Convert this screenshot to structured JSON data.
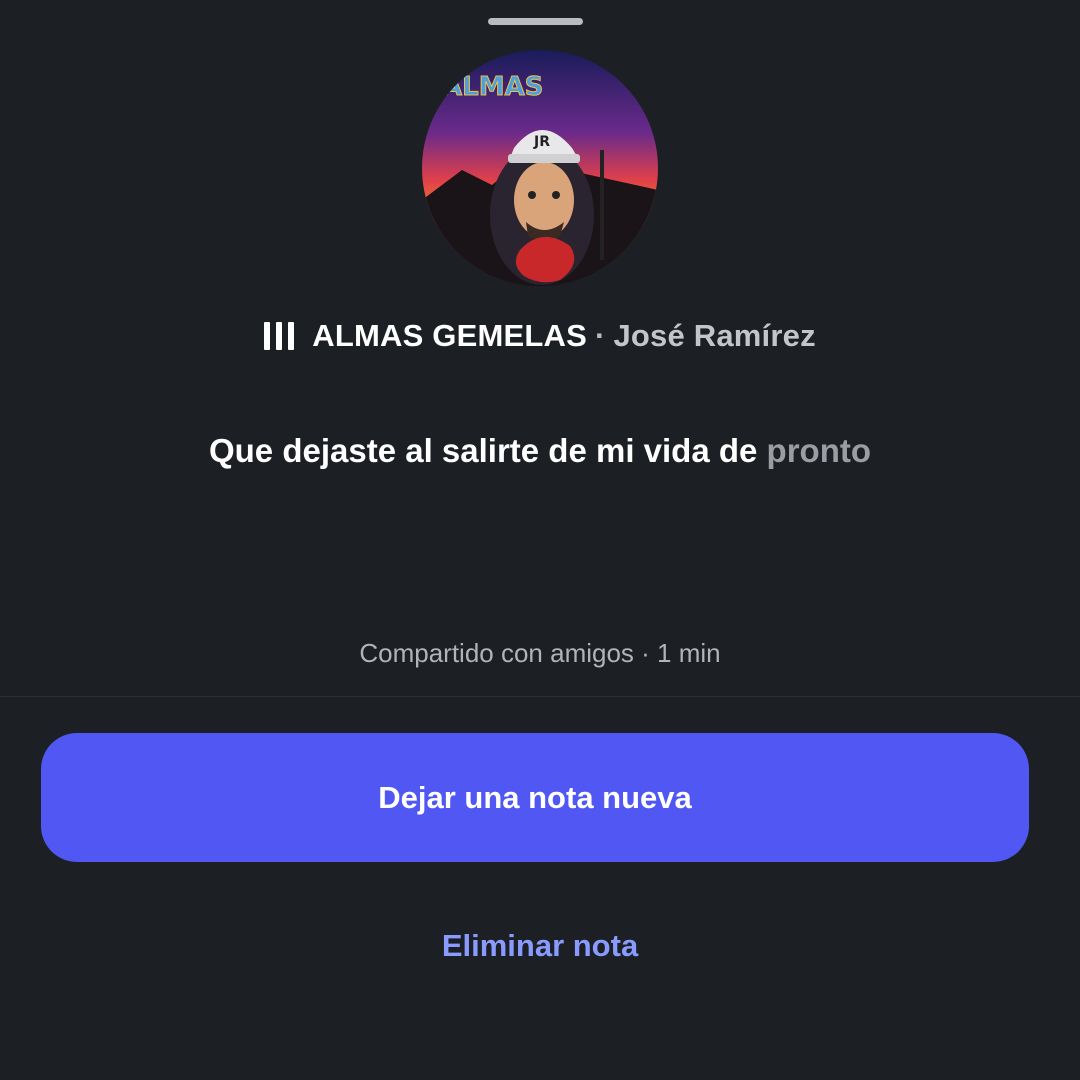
{
  "sheet": {
    "song": {
      "icon": "equalizer-bars-icon",
      "title": "ALMAS GEMELAS",
      "separator": "·",
      "artist": "José Ramírez"
    },
    "note": {
      "lyric_main": "Que dejaste al salirte de mi vida de",
      "lyric_dim": "pronto"
    },
    "meta": {
      "shared_text": "Compartido con amigos · 1 min"
    },
    "actions": {
      "primary_label": "Dejar una nota nueva",
      "secondary_label": "Eliminar nota"
    },
    "avatar_icon": "profile-avatar"
  },
  "colors": {
    "background": "#1c1f23",
    "primary_button": "#5057f2",
    "link": "#8a9bff",
    "muted_text": "#b0b3b8"
  }
}
